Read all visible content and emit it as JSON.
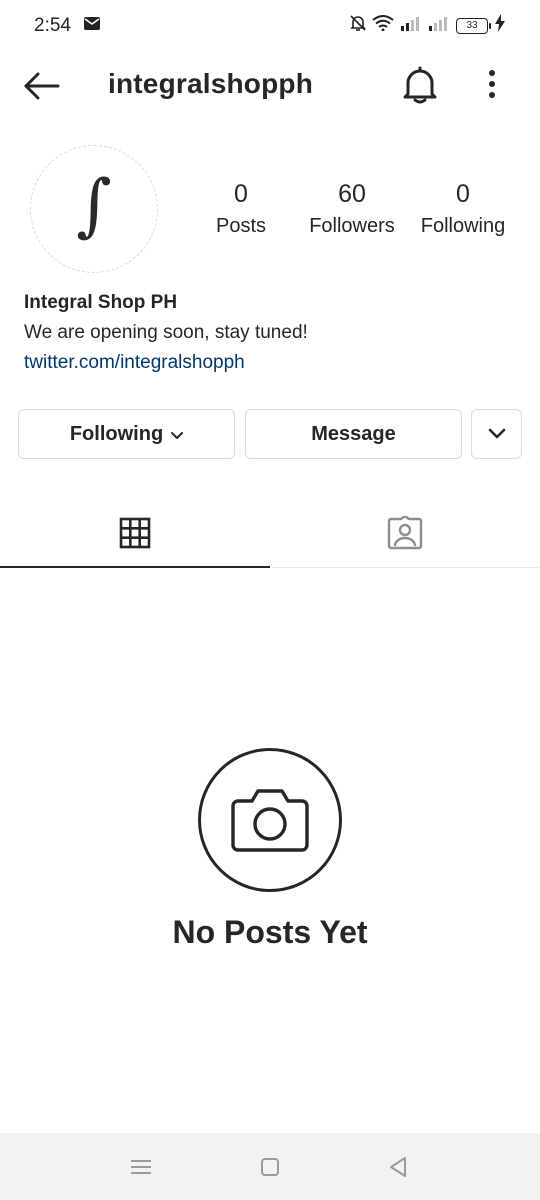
{
  "status_bar": {
    "time": "2:54",
    "battery": "33",
    "icons": [
      "mail-icon",
      "mute-bell-icon",
      "wifi-icon",
      "signal-icon",
      "signal-icon-2",
      "battery-icon",
      "charging-icon"
    ]
  },
  "header": {
    "username": "integralshopph",
    "icons": [
      "back-arrow-icon",
      "bell-icon",
      "more-vertical-icon"
    ]
  },
  "profile": {
    "avatar_glyph": "∫",
    "stats": {
      "posts": {
        "value": "0",
        "label": "Posts"
      },
      "followers": {
        "value": "60",
        "label": "Followers"
      },
      "following": {
        "value": "0",
        "label": "Following"
      }
    },
    "name": "Integral Shop PH",
    "bio": "We are opening soon, stay tuned!",
    "link": "twitter.com/integralshopph"
  },
  "actions": {
    "following_label": "Following",
    "message_label": "Message"
  },
  "tabs": [
    {
      "name": "grid",
      "icon": "grid-icon",
      "active": true
    },
    {
      "name": "tagged",
      "icon": "tagged-person-icon",
      "active": false
    }
  ],
  "empty_state": {
    "icon": "camera-icon",
    "title": "No Posts Yet"
  },
  "nav_bar": {
    "icons": [
      "menu-icon",
      "home-square-icon",
      "back-triangle-icon"
    ]
  },
  "colors": {
    "text": "#262626",
    "link": "#00376b",
    "border": "#dbdbdb",
    "nav_bg": "#f2f2f2"
  }
}
